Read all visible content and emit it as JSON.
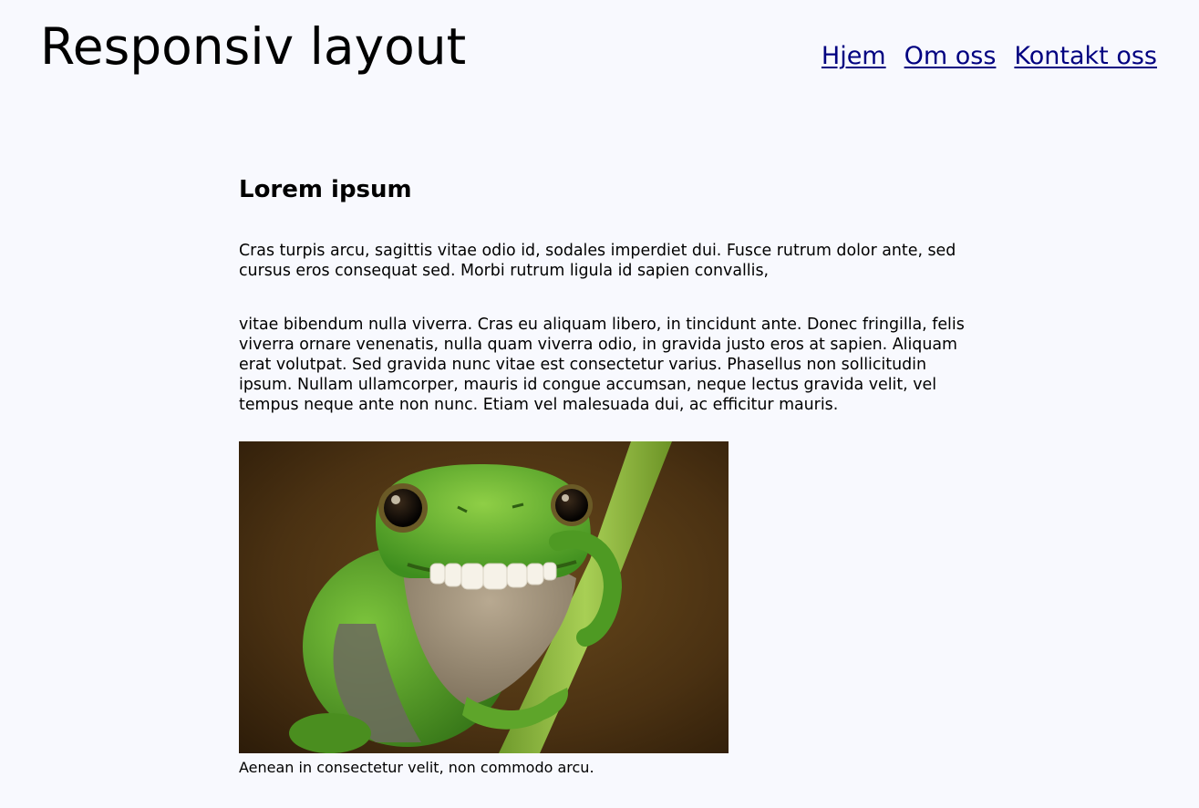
{
  "header": {
    "site_title": "Responsiv layout",
    "nav": [
      {
        "label": "Hjem"
      },
      {
        "label": "Om oss"
      },
      {
        "label": "Kontakt oss"
      }
    ]
  },
  "main": {
    "heading": "Lorem ipsum",
    "paragraphs": [
      "Cras turpis arcu, sagittis vitae odio id, sodales imperdiet dui. Fusce rutrum dolor ante, sed cursus eros consequat sed. Morbi rutrum ligula id sapien convallis,",
      "vitae bibendum nulla viverra. Cras eu aliquam libero, in tincidunt ante. Donec fringilla, felis viverra ornare venenatis, nulla quam viverra odio, in gravida justo eros at sapien. Aliquam erat volutpat. Sed gravida nunc vitae est consectetur varius. Phasellus non sollicitudin ipsum. Nullam ullamcorper, mauris id congue accumsan, neque lectus gravida velit, vel tempus neque ante non nunc. Etiam vel malesuada dui, ac efficitur mauris."
    ],
    "figure": {
      "caption": "Aenean in consectetur velit, non commodo arcu."
    }
  },
  "colors": {
    "background": "#f8f9fe",
    "link": "#000080",
    "text": "#000000"
  }
}
